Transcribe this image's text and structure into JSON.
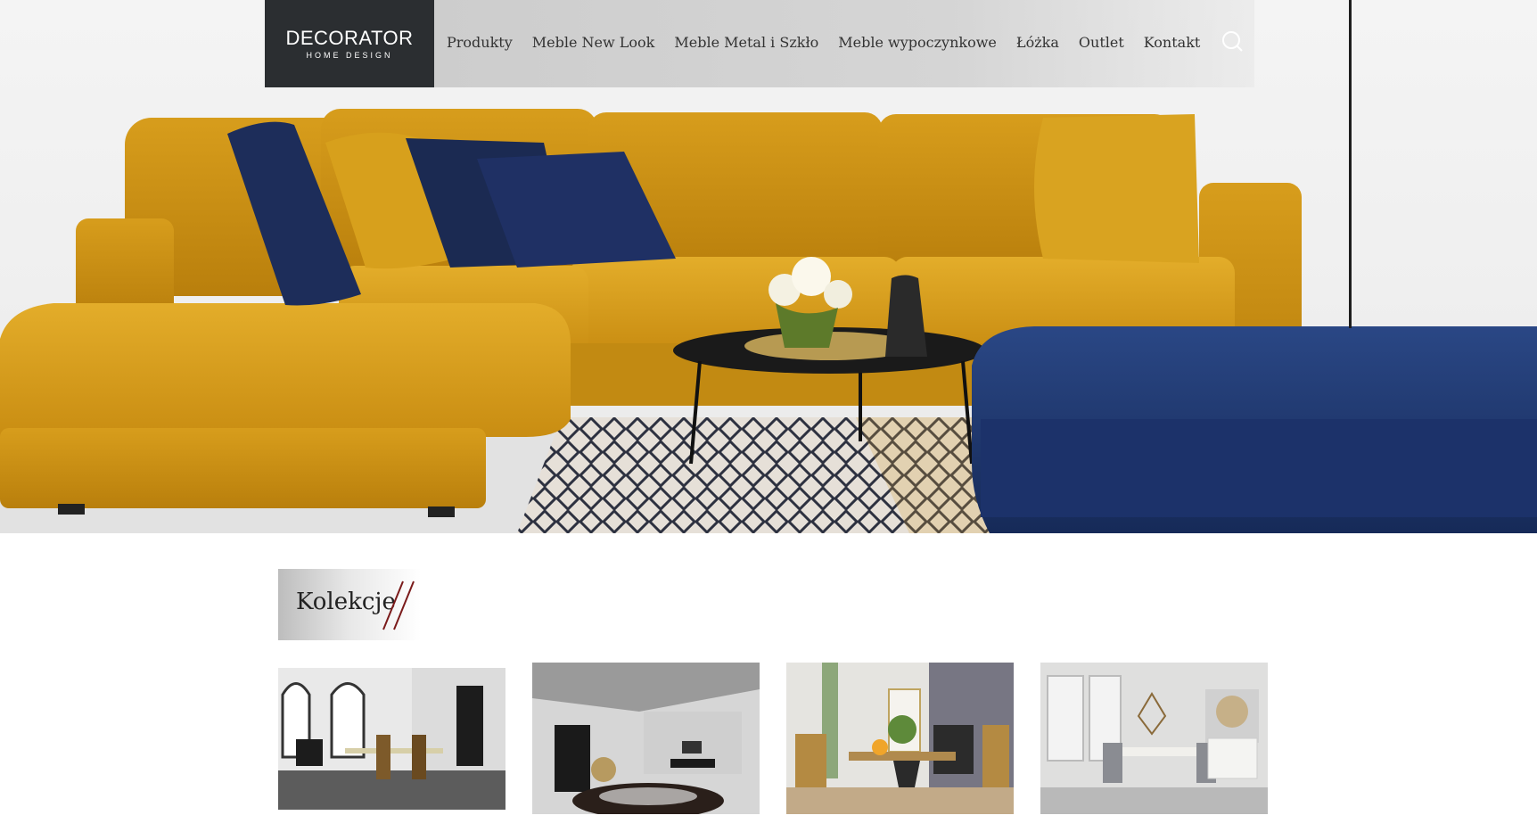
{
  "logo": {
    "main": "DECORATOR",
    "sub": "HOME DESIGN"
  },
  "nav": {
    "items": [
      "Produkty",
      "Meble New Look",
      "Meble Metal i Szkło",
      "Meble wypoczynkowe",
      "Łóżka",
      "Outlet",
      "Kontakt"
    ],
    "search_icon": "search-icon"
  },
  "hero": {
    "image": "hero-sofa-image"
  },
  "collections": {
    "title": "Kolekcje",
    "cards": [
      {
        "image": "collection-image-1",
        "label": ""
      },
      {
        "image": "collection-image-2",
        "label": ""
      },
      {
        "image": "collection-image-3",
        "label": ""
      },
      {
        "image": "collection-image-4",
        "label": ""
      }
    ]
  },
  "colors": {
    "mustard": "#d9a21b",
    "navy": "#1f3668",
    "logo_bg": "#2b2e31",
    "accent": "#7a1a1a"
  }
}
